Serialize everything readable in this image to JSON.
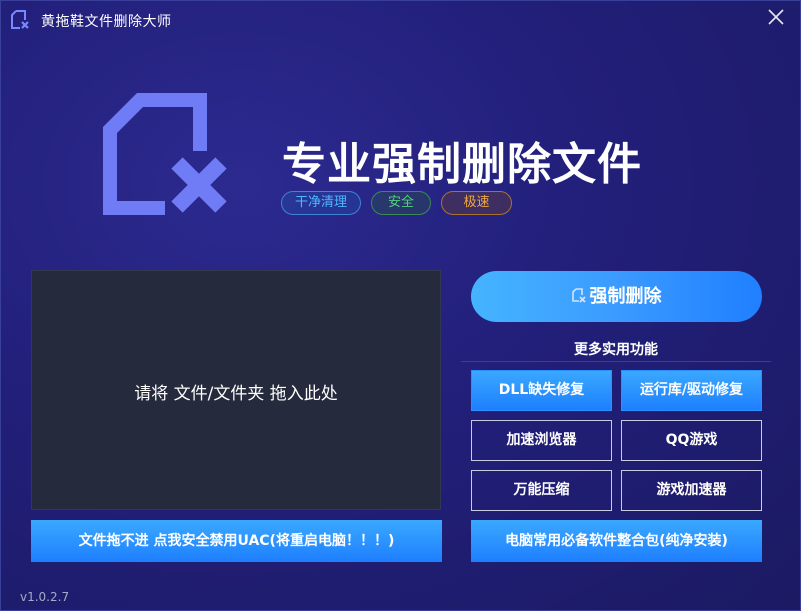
{
  "app": {
    "title": "黄拖鞋文件删除大师",
    "version": "v1.0.2.7"
  },
  "hero": {
    "title": "专业强制删除文件",
    "tags": [
      "干净清理",
      "安全",
      "极速"
    ]
  },
  "drop_zone": {
    "text": "请将 文件/文件夹 拖入此处"
  },
  "uac_button": {
    "label": "文件拖不进 点我安全禁用UAC(将重启电脑！！！)"
  },
  "force_delete_button": {
    "label": "强制删除"
  },
  "more": {
    "title": "更多实用功能",
    "buttons": [
      "DLL缺失修复",
      "运行库/驱动修复",
      "加速浏览器",
      "QQ游戏",
      "万能压缩",
      "游戏加速器"
    ],
    "pack_label": "电脑常用必备软件整合包(纯净安装)"
  },
  "icons": {
    "app": "file-delete-icon",
    "close": "close-icon",
    "hero": "file-delete-icon"
  },
  "colors": {
    "accent": "#2a8fff",
    "tag_clean": "#4fb6ff",
    "tag_safe": "#52d07c",
    "tag_fast": "#f2a93b"
  }
}
